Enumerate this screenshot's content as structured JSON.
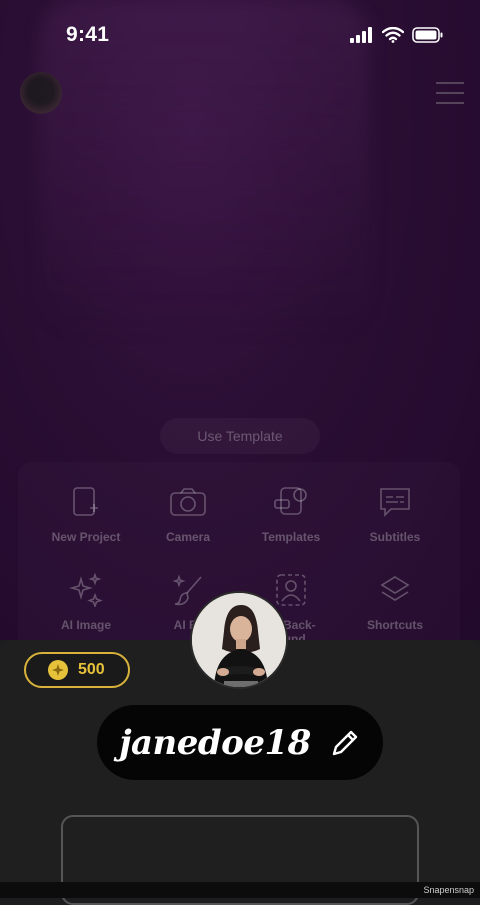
{
  "status_bar": {
    "time": "9:41"
  },
  "background": {
    "use_template_label": "Use Template",
    "tools": [
      {
        "label": "New Project",
        "icon": "new-project-icon"
      },
      {
        "label": "Camera",
        "icon": "camera-icon"
      },
      {
        "label": "Templates",
        "icon": "templates-icon"
      },
      {
        "label": "Subtitles",
        "icon": "subtitles-icon"
      },
      {
        "label": "AI Image",
        "icon": "sparkles-icon"
      },
      {
        "label": "AI Br",
        "icon": "brush-icon"
      },
      {
        "label": "ve Back-\nound",
        "icon": "remove-background-icon"
      },
      {
        "label": "Shortcuts",
        "icon": "layers-icon"
      }
    ]
  },
  "profile": {
    "coins": "500",
    "username": "janedoe18"
  },
  "watermark": "Snapensnap",
  "colors": {
    "accent_gold": "#e6c23a",
    "sheet": "#1f1f20",
    "background_purple": "#2a0e33"
  }
}
